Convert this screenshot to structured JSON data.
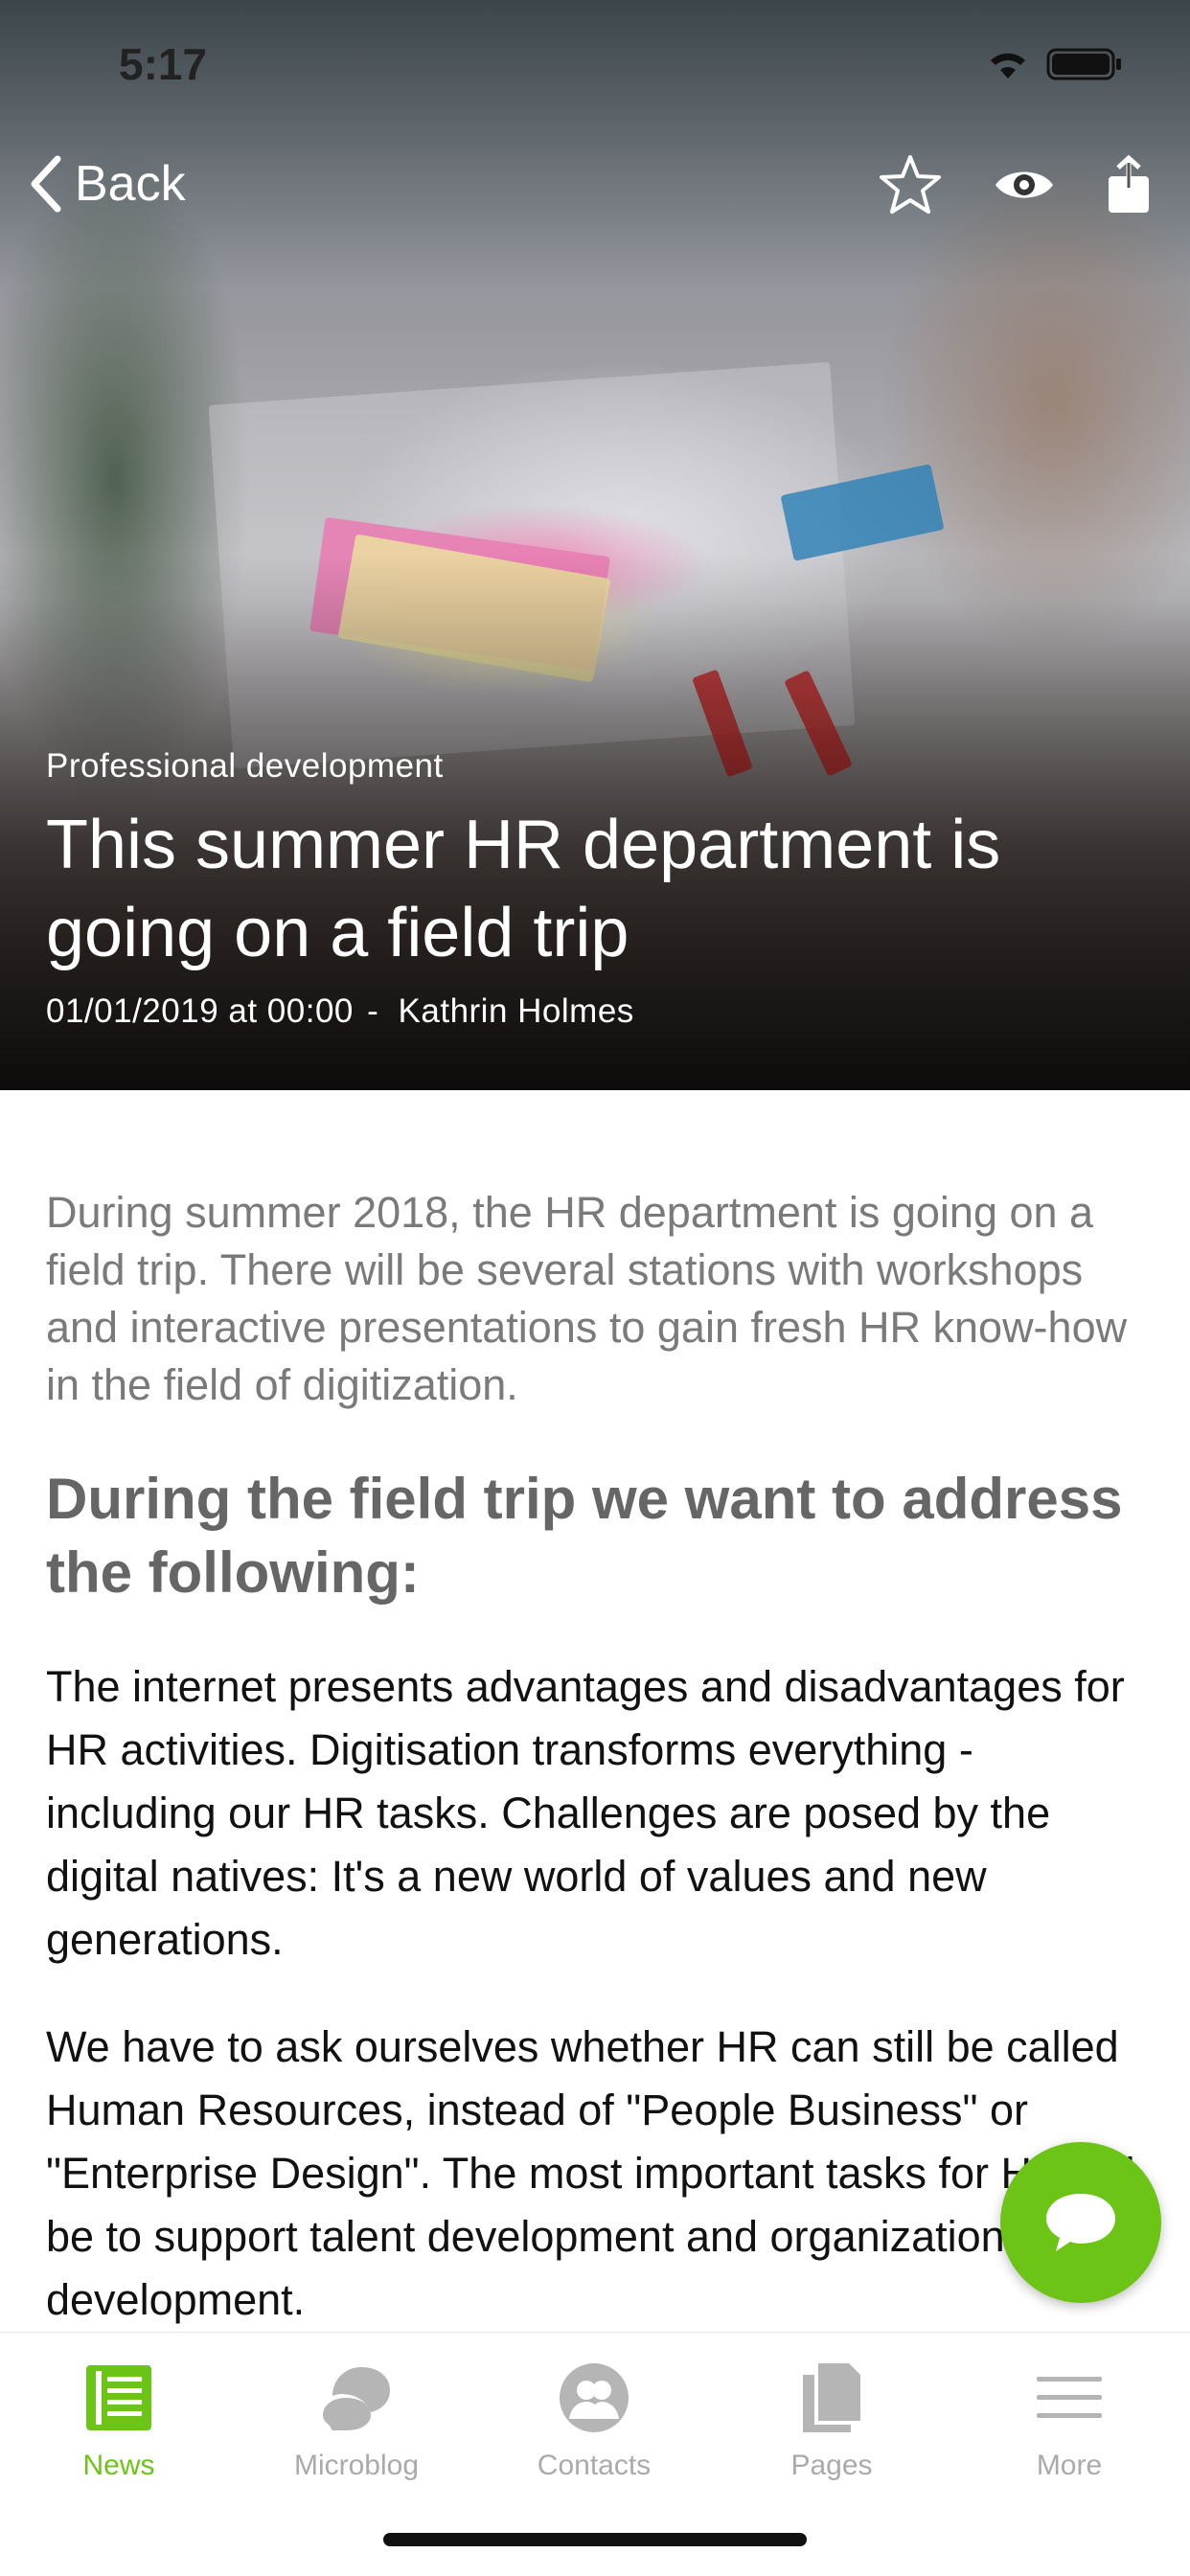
{
  "status_bar": {
    "time": "5:17"
  },
  "nav": {
    "back_label": "Back"
  },
  "article": {
    "category": "Professional development",
    "title": "This summer HR department is going on a field trip",
    "date": "01/01/2019 at 00:00",
    "separator": "-",
    "author": "Kathrin Holmes",
    "lead": "During summer 2018, the HR department is going on a field trip. There will be several stations with workshops and interactive presentations to gain fresh HR know-how in the field of digitization.",
    "subheading": "During the field trip we want to address the following:",
    "paragraphs": [
      "The internet presents advantages and disadvantages for HR activities. Digitisation transforms everything - including our HR tasks. Challenges are posed by the digital natives: It's a new world of values and new generations.",
      "We have to ask ourselves whether HR can still be called Human Resources, instead of \"People Business\" or \"Enterprise Design\". The most important tasks for HR will be to support talent development and organizational development."
    ]
  },
  "tabbar": {
    "items": [
      {
        "label": "News",
        "icon": "news-icon",
        "active": true
      },
      {
        "label": "Microblog",
        "icon": "microblog-icon",
        "active": false
      },
      {
        "label": "Contacts",
        "icon": "contacts-icon",
        "active": false
      },
      {
        "label": "Pages",
        "icon": "pages-icon",
        "active": false
      },
      {
        "label": "More",
        "icon": "menu-icon",
        "active": false
      }
    ]
  },
  "colors": {
    "accent": "#6cc417",
    "inactive": "#aaaaaa",
    "lead_text": "#7a7a7a"
  }
}
